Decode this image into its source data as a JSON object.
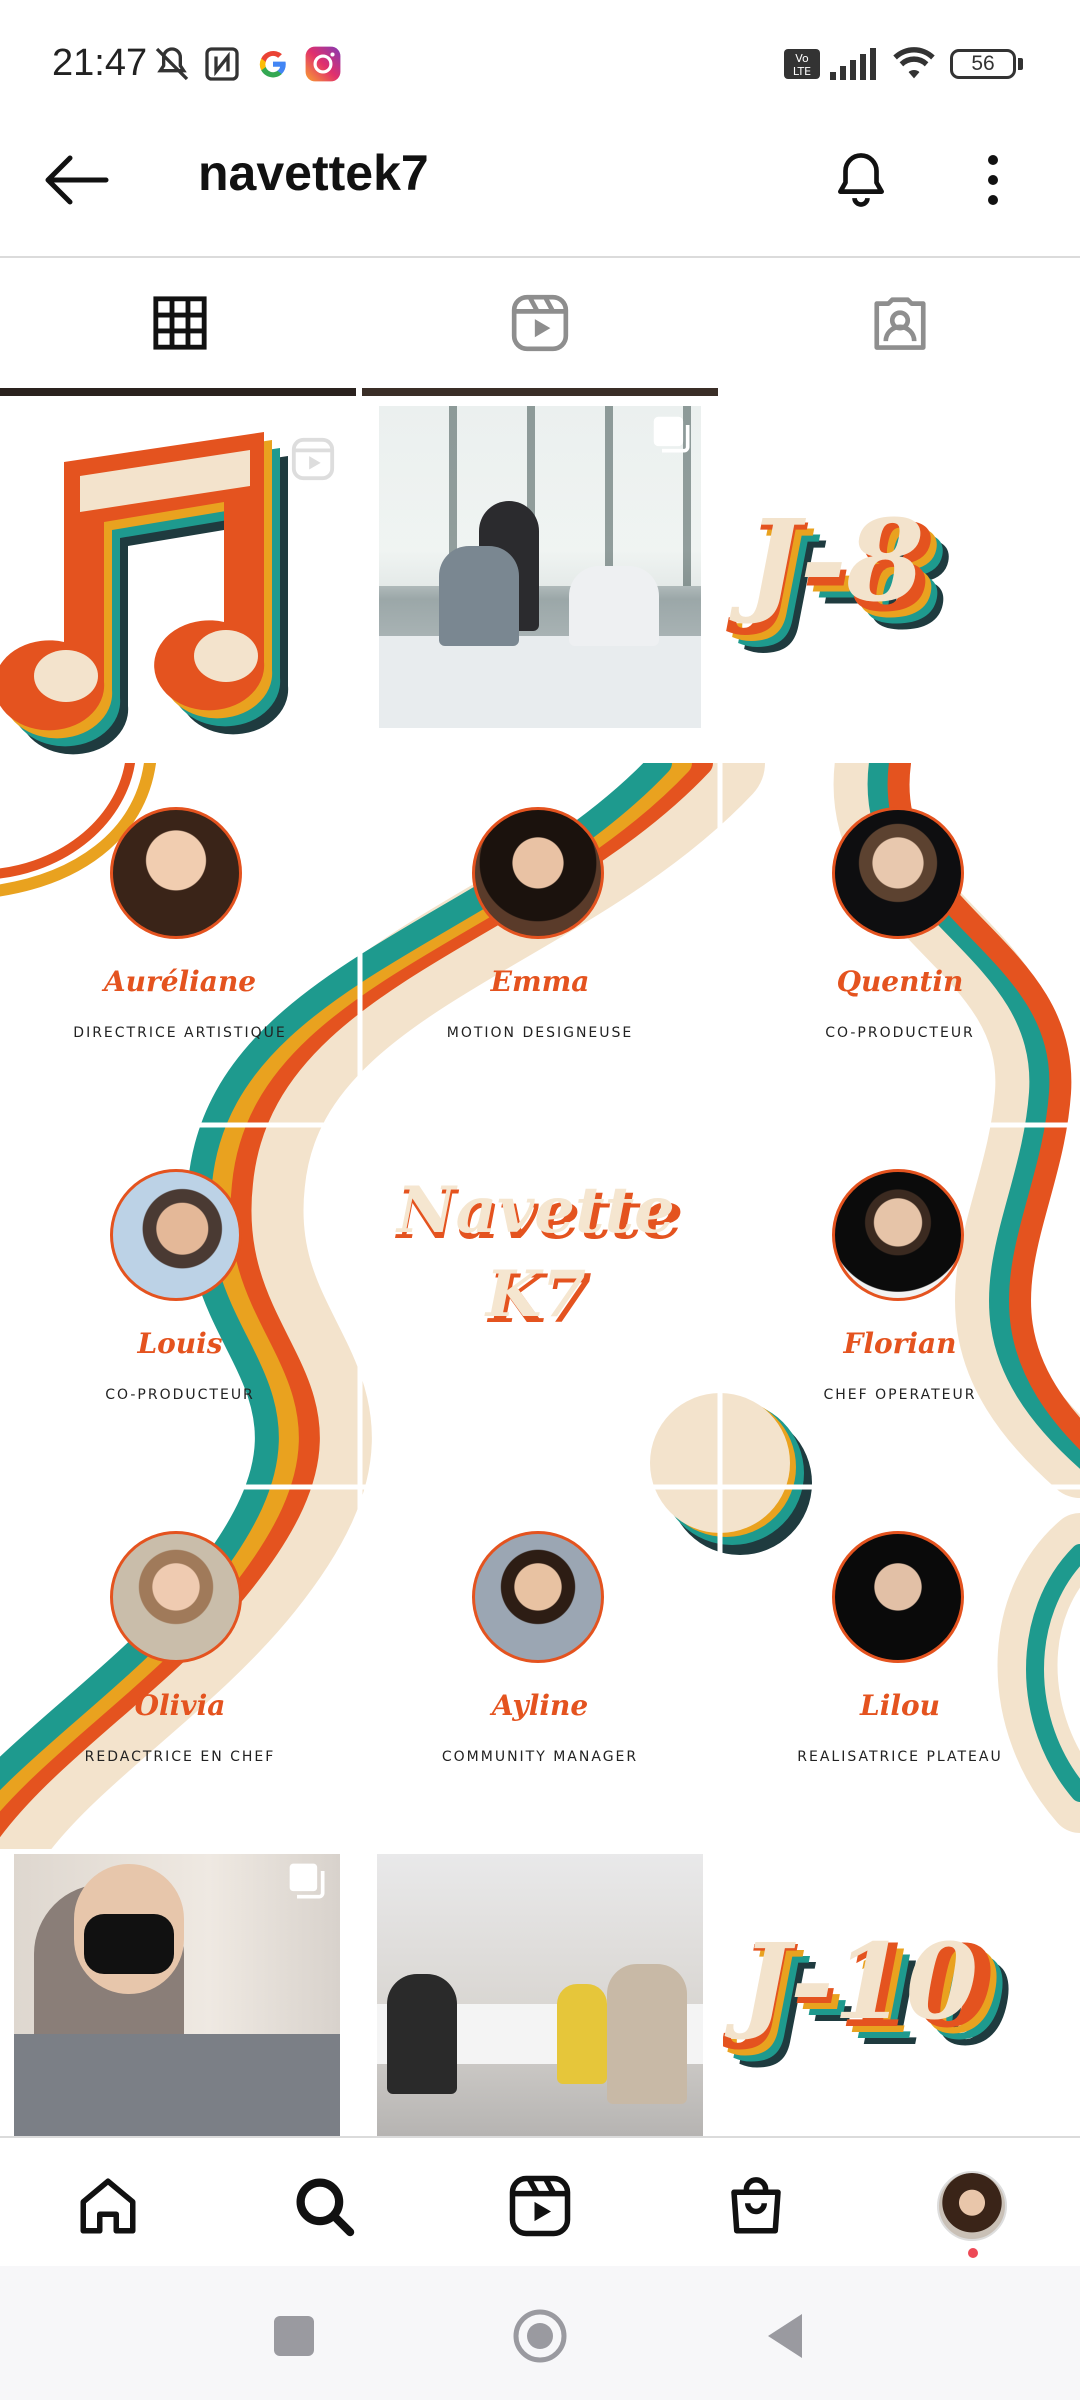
{
  "status_bar": {
    "time": "21:47",
    "battery": "56",
    "icons": [
      "mute-icon",
      "nfc-icon",
      "google-icon",
      "instagram-icon",
      "volte-icon",
      "signal-icon",
      "wifi-icon",
      "battery-icon"
    ]
  },
  "header": {
    "username": "navettek7",
    "back_icon": "arrow-left-icon",
    "bell_icon": "bell-icon",
    "menu_icon": "more-vertical-icon"
  },
  "tabs": [
    {
      "name": "grid-tab",
      "icon": "grid-icon",
      "active": true
    },
    {
      "name": "reels-tab",
      "icon": "reels-icon",
      "active": false
    },
    {
      "name": "tagged-tab",
      "icon": "tagged-icon",
      "active": false
    }
  ],
  "posts": {
    "countdown_top": "J-8",
    "countdown_bottom": "J-10",
    "logo_line1": "Navette",
    "logo_line2": "K7",
    "team": [
      {
        "name": "Auréliane",
        "role": "DIRECTRICE ARTISTIQUE"
      },
      {
        "name": "Emma",
        "role": "MOTION DESIGNEUSE"
      },
      {
        "name": "Quentin",
        "role": "CO-PRODUCTEUR"
      },
      {
        "name": "Louis",
        "role": "CO-PRODUCTEUR"
      },
      {
        "name": "Florian",
        "role": "CHEF OPERATEUR"
      },
      {
        "name": "Olivia",
        "role": "REDACTRICE EN CHEF"
      },
      {
        "name": "Ayline",
        "role": "COMMUNITY MANAGER"
      },
      {
        "name": "Lilou",
        "role": "REALISATRICE PLATEAU"
      }
    ]
  },
  "colors": {
    "orange": "#e4531f",
    "amber": "#e9a21f",
    "teal": "#1e9a8e",
    "cream": "#f3e3cc",
    "dark": "#1f3b3f"
  },
  "bottom_nav": [
    "home-icon",
    "search-icon",
    "reels-icon",
    "shop-icon",
    "profile-avatar"
  ]
}
